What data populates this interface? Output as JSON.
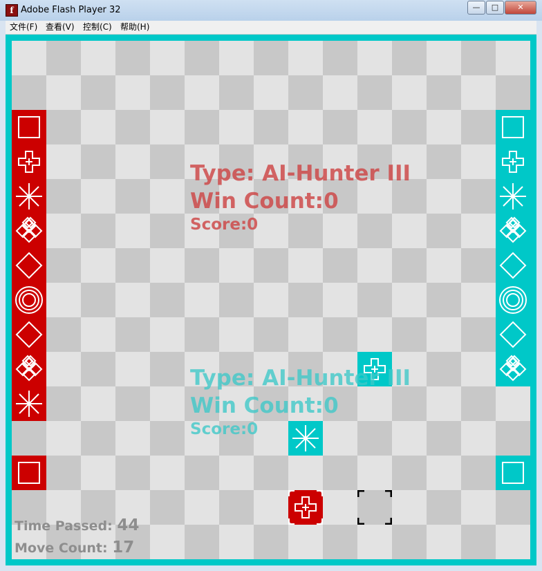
{
  "window": {
    "title": "Adobe Flash Player 32",
    "minimize": "—",
    "maximize": "□",
    "close": "✕",
    "icon": "flash-icon"
  },
  "menu": [
    {
      "label": "文件(F)"
    },
    {
      "label": "查看(V)"
    },
    {
      "label": "控制(C)"
    },
    {
      "label": "帮助(H)"
    }
  ],
  "colors": {
    "red_player": "#cc0000",
    "cyan_player": "#00c8c8",
    "light_square": "#e3e3e3",
    "dark_square": "#c8c8c8",
    "frame": "#00c8c8"
  },
  "players": {
    "red": {
      "type_label": "Type:",
      "type_value": "AI-Hunter III",
      "win_label": "Win Count:",
      "win_value": "0",
      "score_label": "Score:",
      "score_value": "0"
    },
    "cyan": {
      "type_label": "Type:",
      "type_value": "AI-Hunter III",
      "win_label": "Win Count:",
      "win_value": "0",
      "score_label": "Score:",
      "score_value": "0"
    }
  },
  "stats": {
    "time_label": "Time Passed:",
    "time_value": "44",
    "moves_label": "Move Count:",
    "moves_value": "17"
  },
  "board": {
    "columns": 15,
    "rows": 15,
    "pieces": [
      {
        "player": "red",
        "shape": "square",
        "col": 0,
        "row": 2
      },
      {
        "player": "red",
        "shape": "cross",
        "col": 0,
        "row": 3
      },
      {
        "player": "red",
        "shape": "star",
        "col": 0,
        "row": 4
      },
      {
        "player": "red",
        "shape": "quad",
        "col": 0,
        "row": 5
      },
      {
        "player": "red",
        "shape": "diamond",
        "col": 0,
        "row": 6
      },
      {
        "player": "red",
        "shape": "king",
        "col": 0,
        "row": 7
      },
      {
        "player": "red",
        "shape": "diamond",
        "col": 0,
        "row": 8
      },
      {
        "player": "red",
        "shape": "quad",
        "col": 0,
        "row": 9
      },
      {
        "player": "red",
        "shape": "star",
        "col": 0,
        "row": 10
      },
      {
        "player": "red",
        "shape": "square",
        "col": 0,
        "row": 12
      },
      {
        "player": "red",
        "shape": "cross",
        "col": 8,
        "row": 13,
        "selected": true
      },
      {
        "player": "cyan",
        "shape": "square",
        "col": 14,
        "row": 2
      },
      {
        "player": "cyan",
        "shape": "cross",
        "col": 14,
        "row": 3
      },
      {
        "player": "cyan",
        "shape": "star",
        "col": 14,
        "row": 4
      },
      {
        "player": "cyan",
        "shape": "quad",
        "col": 14,
        "row": 5
      },
      {
        "player": "cyan",
        "shape": "diamond",
        "col": 14,
        "row": 6
      },
      {
        "player": "cyan",
        "shape": "king",
        "col": 14,
        "row": 7
      },
      {
        "player": "cyan",
        "shape": "diamond",
        "col": 14,
        "row": 8
      },
      {
        "player": "cyan",
        "shape": "quad",
        "col": 14,
        "row": 9
      },
      {
        "player": "cyan",
        "shape": "square",
        "col": 14,
        "row": 12
      },
      {
        "player": "cyan",
        "shape": "cross",
        "col": 10,
        "row": 9
      },
      {
        "player": "cyan",
        "shape": "star",
        "col": 8,
        "row": 11
      }
    ],
    "target": {
      "col": 10,
      "row": 13
    }
  }
}
